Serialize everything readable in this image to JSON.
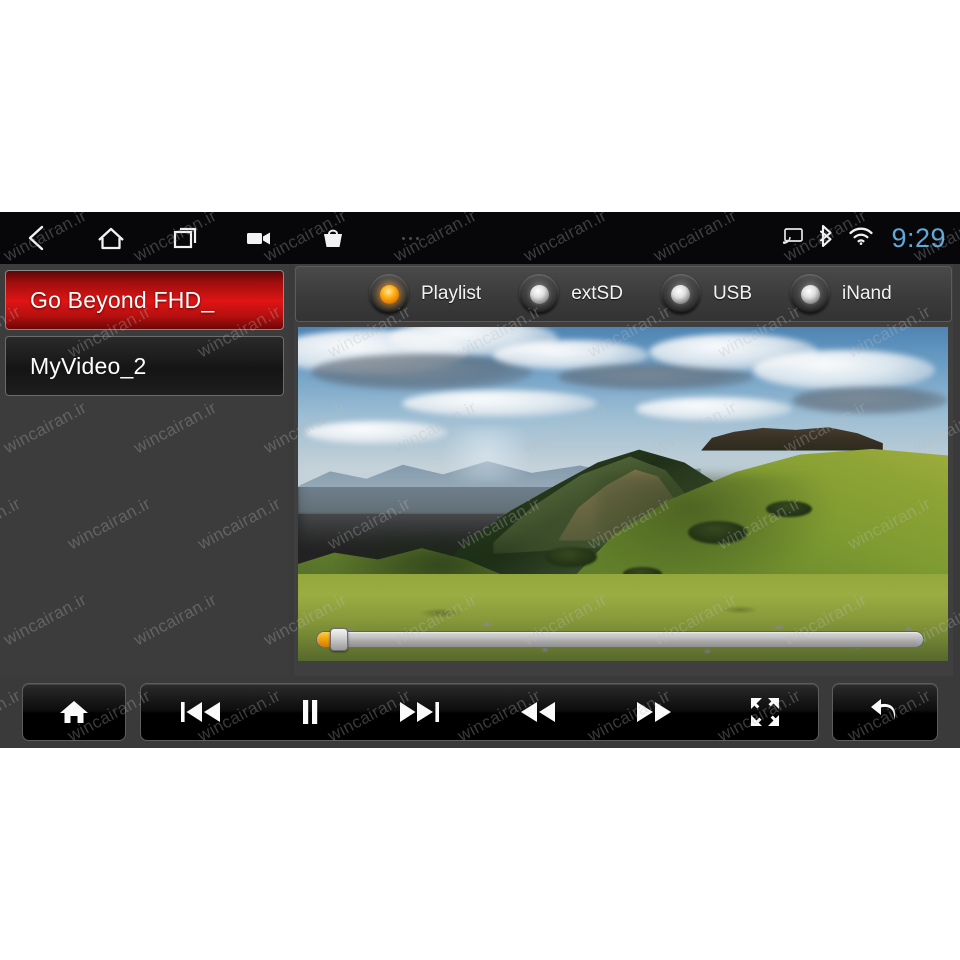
{
  "watermark": {
    "text": "wincairan.ir"
  },
  "statusbar": {
    "nav": [
      {
        "name": "back-icon",
        "label": "Back"
      },
      {
        "name": "home-icon",
        "label": "Home"
      },
      {
        "name": "recent-apps-icon",
        "label": "Recent apps"
      },
      {
        "name": "video-camera-icon",
        "label": "Camera"
      },
      {
        "name": "basket-icon",
        "label": "Market"
      },
      {
        "name": "overflow-menu-icon",
        "label": "More"
      }
    ],
    "indicators": [
      {
        "name": "cast-icon",
        "label": "Cast"
      },
      {
        "name": "bluetooth-icon",
        "label": "Bluetooth"
      },
      {
        "name": "wifi-icon",
        "label": "Wi-Fi"
      }
    ],
    "clock": "9:29",
    "clock_color": "#5fa8d8"
  },
  "playlist": {
    "items": [
      {
        "label": "Go Beyond FHD_",
        "selected": true
      },
      {
        "label": "MyVideo_2",
        "selected": false
      }
    ],
    "selected_color": "#e01414"
  },
  "sources": [
    {
      "label": "Playlist",
      "selected": true
    },
    {
      "label": "extSD",
      "selected": false
    },
    {
      "label": "USB",
      "selected": false
    },
    {
      "label": "iNand",
      "selected": false
    }
  ],
  "source_selected_color": "#ffb61e",
  "video": {
    "title": "Go Beyond FHD_",
    "scene": "mountain-landscape",
    "seek": {
      "progress_percent": 2,
      "fill_color": "#f0a513",
      "track_color": "#c6c6c6"
    }
  },
  "controls": {
    "home": {
      "label": "Home",
      "icon": "home-icon"
    },
    "media": [
      {
        "label": "Previous",
        "icon": "previous-track-icon"
      },
      {
        "label": "Pause",
        "icon": "pause-icon"
      },
      {
        "label": "Next",
        "icon": "next-track-icon"
      },
      {
        "label": "Rewind",
        "icon": "rewind-icon"
      },
      {
        "label": "Fast forward",
        "icon": "fast-forward-icon"
      },
      {
        "label": "Full screen",
        "icon": "fullscreen-icon"
      }
    ],
    "back": {
      "label": "Back",
      "icon": "return-arrow-icon"
    }
  }
}
